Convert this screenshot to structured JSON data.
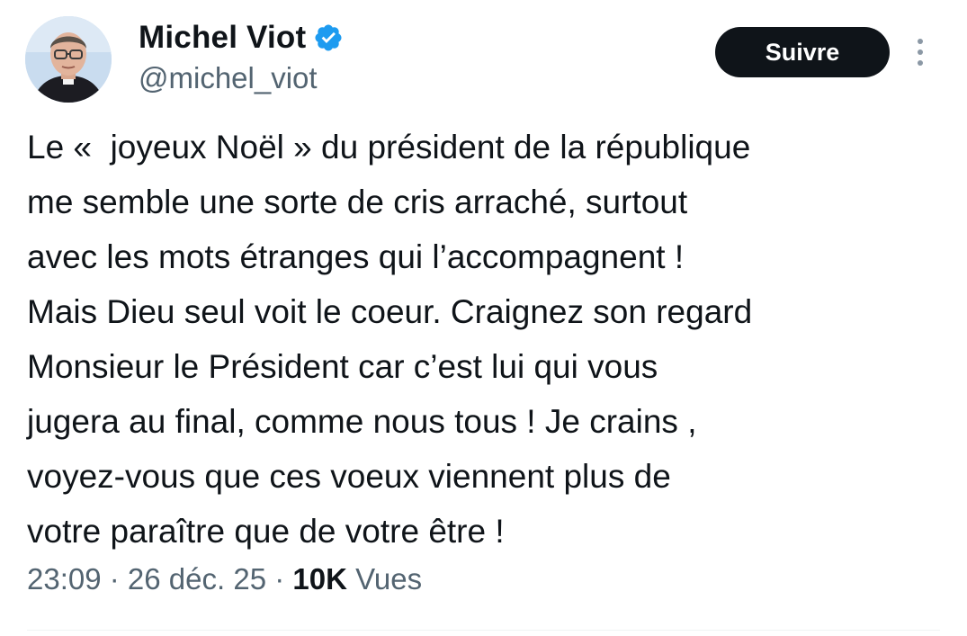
{
  "author": {
    "display_name": "Michel Viot",
    "handle": "@michel_viot",
    "verified_icon": "verified-badge-icon",
    "verified_color": "#1d9bf0"
  },
  "actions": {
    "follow_label": "Suivre",
    "more_icon": "more-vertical-icon"
  },
  "tweet": {
    "lines": [
      "Le «  joyeux Noël » du président de la république",
      "me semble une sorte de cris arraché, surtout",
      "avec les mots étranges qui l’accompagnent !",
      "Mais Dieu seul voit le coeur. Craignez son regard",
      "Monsieur le Président car c’est lui qui vous",
      "jugera au final, comme nous tous ! Je crains ,",
      "voyez-vous que ces voeux viennent plus de",
      "votre paraître que de votre être !"
    ]
  },
  "meta": {
    "time": "23:09",
    "separator": " · ",
    "date": "26 déc. 25",
    "views_count": "10K",
    "views_label": "Vues"
  },
  "colors": {
    "text_primary": "#0f1419",
    "text_secondary": "#536471",
    "button_bg": "#0f1419",
    "button_text": "#ffffff"
  }
}
